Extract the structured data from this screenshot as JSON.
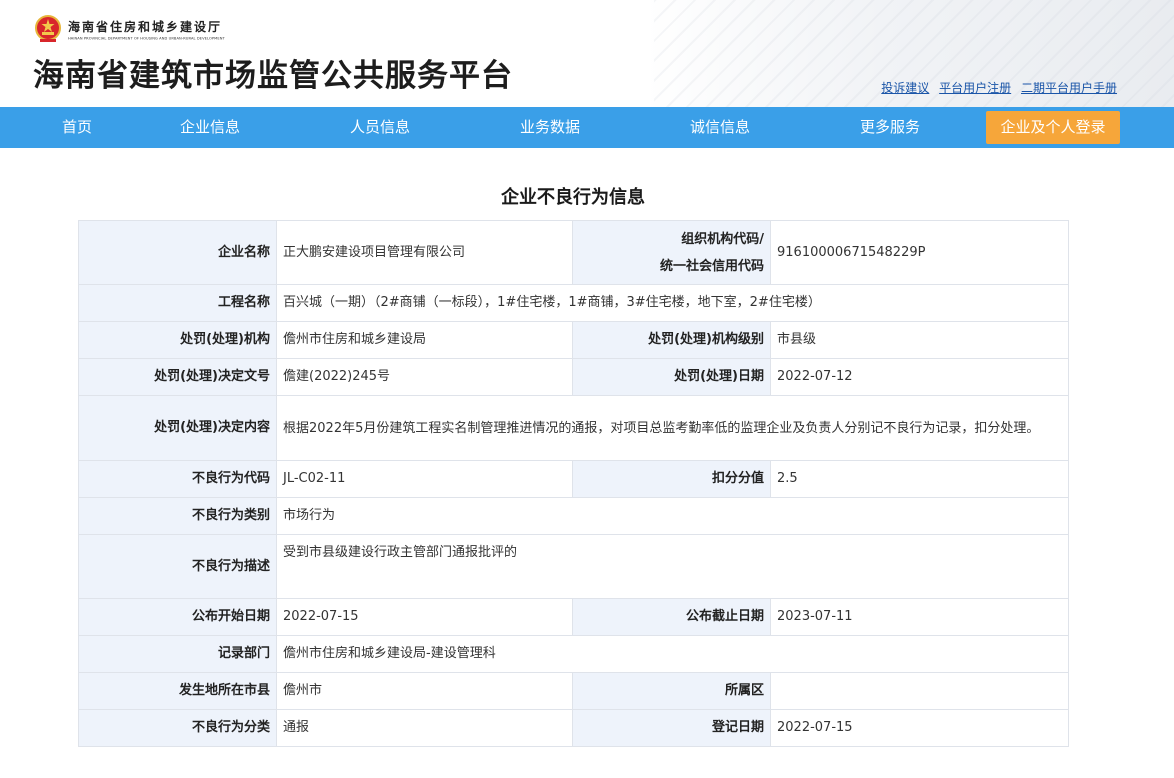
{
  "header": {
    "dept_cn": "海南省住房和城乡建设厅",
    "dept_en": "HAINAN PROVINCIAL DEPARTMENT OF HOUSING AND URBAN-RURAL DEVELOPMENT",
    "platform_title": "海南省建筑市场监管公共服务平台",
    "links": [
      "投诉建议",
      "平台用户注册",
      "二期平台用户手册"
    ]
  },
  "nav": {
    "items": [
      "首页",
      "企业信息",
      "人员信息",
      "业务数据",
      "诚信信息",
      "更多服务"
    ],
    "login": "企业及个人登录",
    "color": "#3a9fe8",
    "login_color": "#f6a63a"
  },
  "page_title": "企业不良行为信息",
  "record": {
    "company_name_label": "企业名称",
    "company_name": "正大鹏安建设项目管理有限公司",
    "org_code_label_1": "组织机构代码/",
    "org_code_label_2": "统一社会信用代码",
    "org_code": "91610000671548229P",
    "project_name_label": "工程名称",
    "project_name": "百兴城（一期）（2#商铺（一标段），1#住宅楼，1#商铺，3#住宅楼，地下室，2#住宅楼）",
    "authority_label": "处罚(处理)机构",
    "authority": "儋州市住房和城乡建设局",
    "authority_level_label": "处罚(处理)机构级别",
    "authority_level": "市县级",
    "doc_no_label": "处罚(处理)决定文号",
    "doc_no": "儋建(2022)245号",
    "decision_date_label": "处罚(处理)日期",
    "decision_date": "2022-07-12",
    "decision_content_label": "处罚(处理)决定内容",
    "decision_content": "根据2022年5月份建筑工程实名制管理推进情况的通报，对项目总监考勤率低的监理企业及负责人分别记不良行为记录，扣分处理。",
    "behavior_code_label": "不良行为代码",
    "behavior_code": "JL-C02-11",
    "deduction_label": "扣分分值",
    "deduction": "2.5",
    "behavior_category_label": "不良行为类别",
    "behavior_category": "市场行为",
    "behavior_desc_label": "不良行为描述",
    "behavior_desc": "受到市县级建设行政主管部门通报批评的",
    "publish_start_label": "公布开始日期",
    "publish_start": "2022-07-15",
    "publish_end_label": "公布截止日期",
    "publish_end": "2023-07-11",
    "record_dept_label": "记录部门",
    "record_dept": "儋州市住房和城乡建设局-建设管理科",
    "city_label": "发生地所在市县",
    "city": "儋州市",
    "district_label": "所属区",
    "district": "",
    "classification_label": "不良行为分类",
    "classification": "通报",
    "register_date_label": "登记日期",
    "register_date": "2022-07-15"
  }
}
